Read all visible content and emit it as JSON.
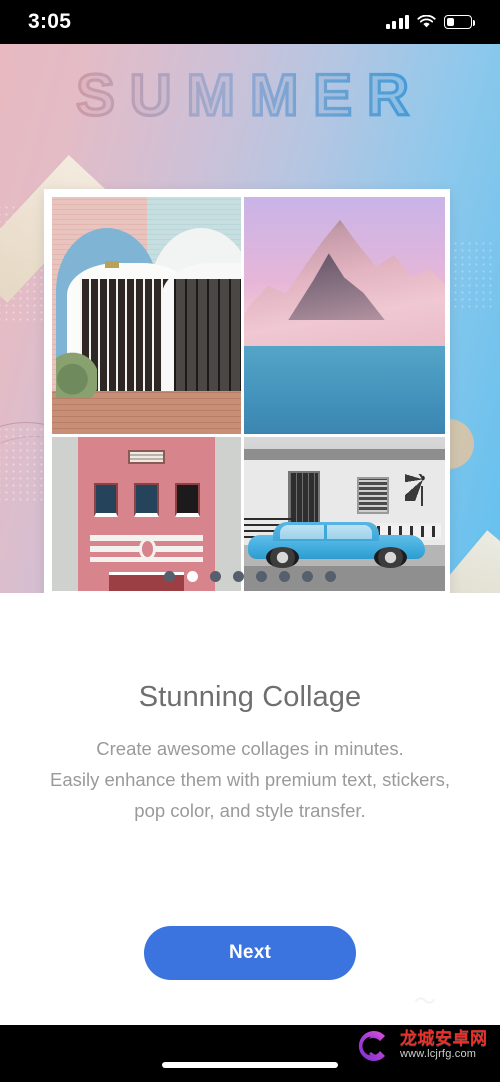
{
  "status_bar": {
    "time": "3:05",
    "signal_icon": "cellular-signal-icon",
    "wifi_icon": "wifi-icon",
    "battery_icon": "battery-icon",
    "battery_level_percent": 32
  },
  "hero": {
    "headline_text": "SUMMER",
    "background_gradient": [
      "#e8b9c0",
      "#cfc0d6",
      "#63c0ee"
    ],
    "decorations": {
      "tape_color": "#efe5d2",
      "circle_accent_color": "#f4c596",
      "ring_outline_color": "#9e6c6c"
    },
    "collage": {
      "frame_color": "#ffffff",
      "cells": [
        {
          "name": "pastel-doorways-photo",
          "description": "Two arched doorways, pink and blue brick"
        },
        {
          "name": "pink-mountain-lake-photo",
          "description": "Pink mountain over blue lake"
        },
        {
          "name": "pink-facade-photo",
          "description": "Pink building facade with windows"
        },
        {
          "name": "blue-car-street-photo",
          "description": "Black and white street with blue car"
        }
      ]
    }
  },
  "pagination": {
    "total": 8,
    "active_index": 1,
    "active_color": "#ffffff",
    "inactive_color": "#56606d"
  },
  "content": {
    "title": "Stunning Collage",
    "description_lines": [
      "Create awesome collages in minutes.",
      "Easily enhance them with premium text, stickers,",
      "pop color, and style transfer."
    ]
  },
  "actions": {
    "next_label": "Next",
    "next_color": "#3b74de"
  },
  "system": {
    "home_indicator": "home-indicator"
  },
  "watermark": {
    "site_name": "龙城安卓网",
    "url": "www.lcjrfg.com",
    "logo_icon": "dragon-c-logo-icon"
  }
}
